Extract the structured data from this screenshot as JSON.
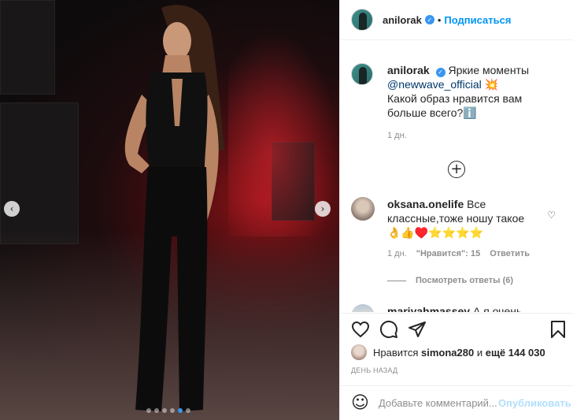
{
  "post": {
    "author": "anilorak",
    "follow_label": "Подписаться",
    "separator": "•",
    "photo_nav": {
      "prev_icon": "chevron-left-icon",
      "next_icon": "chevron-right-icon",
      "slide_count": 6,
      "active_slide": 5
    }
  },
  "caption": {
    "username": "anilorak",
    "line1": "Яркие моменты",
    "mention": "@newwave_official",
    "emoji1": "💥",
    "line2": "Какой образ нравится вам больше всего?",
    "emoji2": "ℹ️",
    "time": "1 дн."
  },
  "load_more_symbol": "+",
  "comments": [
    {
      "username": "oksana.onelife",
      "text": "Все классные,тоже ношу такое👌👍♥️⭐⭐⭐⭐",
      "time": "1 дн.",
      "likes_label": "\"Нравится\": 15",
      "reply_label": "Ответить",
      "view_replies": "Посмотреть ответы (6)"
    },
    {
      "username": "mariyahmassey",
      "text": "А я очень богатый !!! Денег настолько"
    }
  ],
  "likes": {
    "prefix": "Нравится",
    "user": "simona280",
    "connector": "и",
    "rest": "ещё 144 030"
  },
  "posted_label": "ДЕНЬ НАЗАД",
  "add_comment": {
    "placeholder": "Добавьте комментарий...",
    "publish_label": "Опубликовать"
  },
  "colors": {
    "accent": "#0095f6",
    "verified": "#3897f0",
    "muted": "#8e8e8e",
    "publish_disabled": "#b2dffc"
  }
}
